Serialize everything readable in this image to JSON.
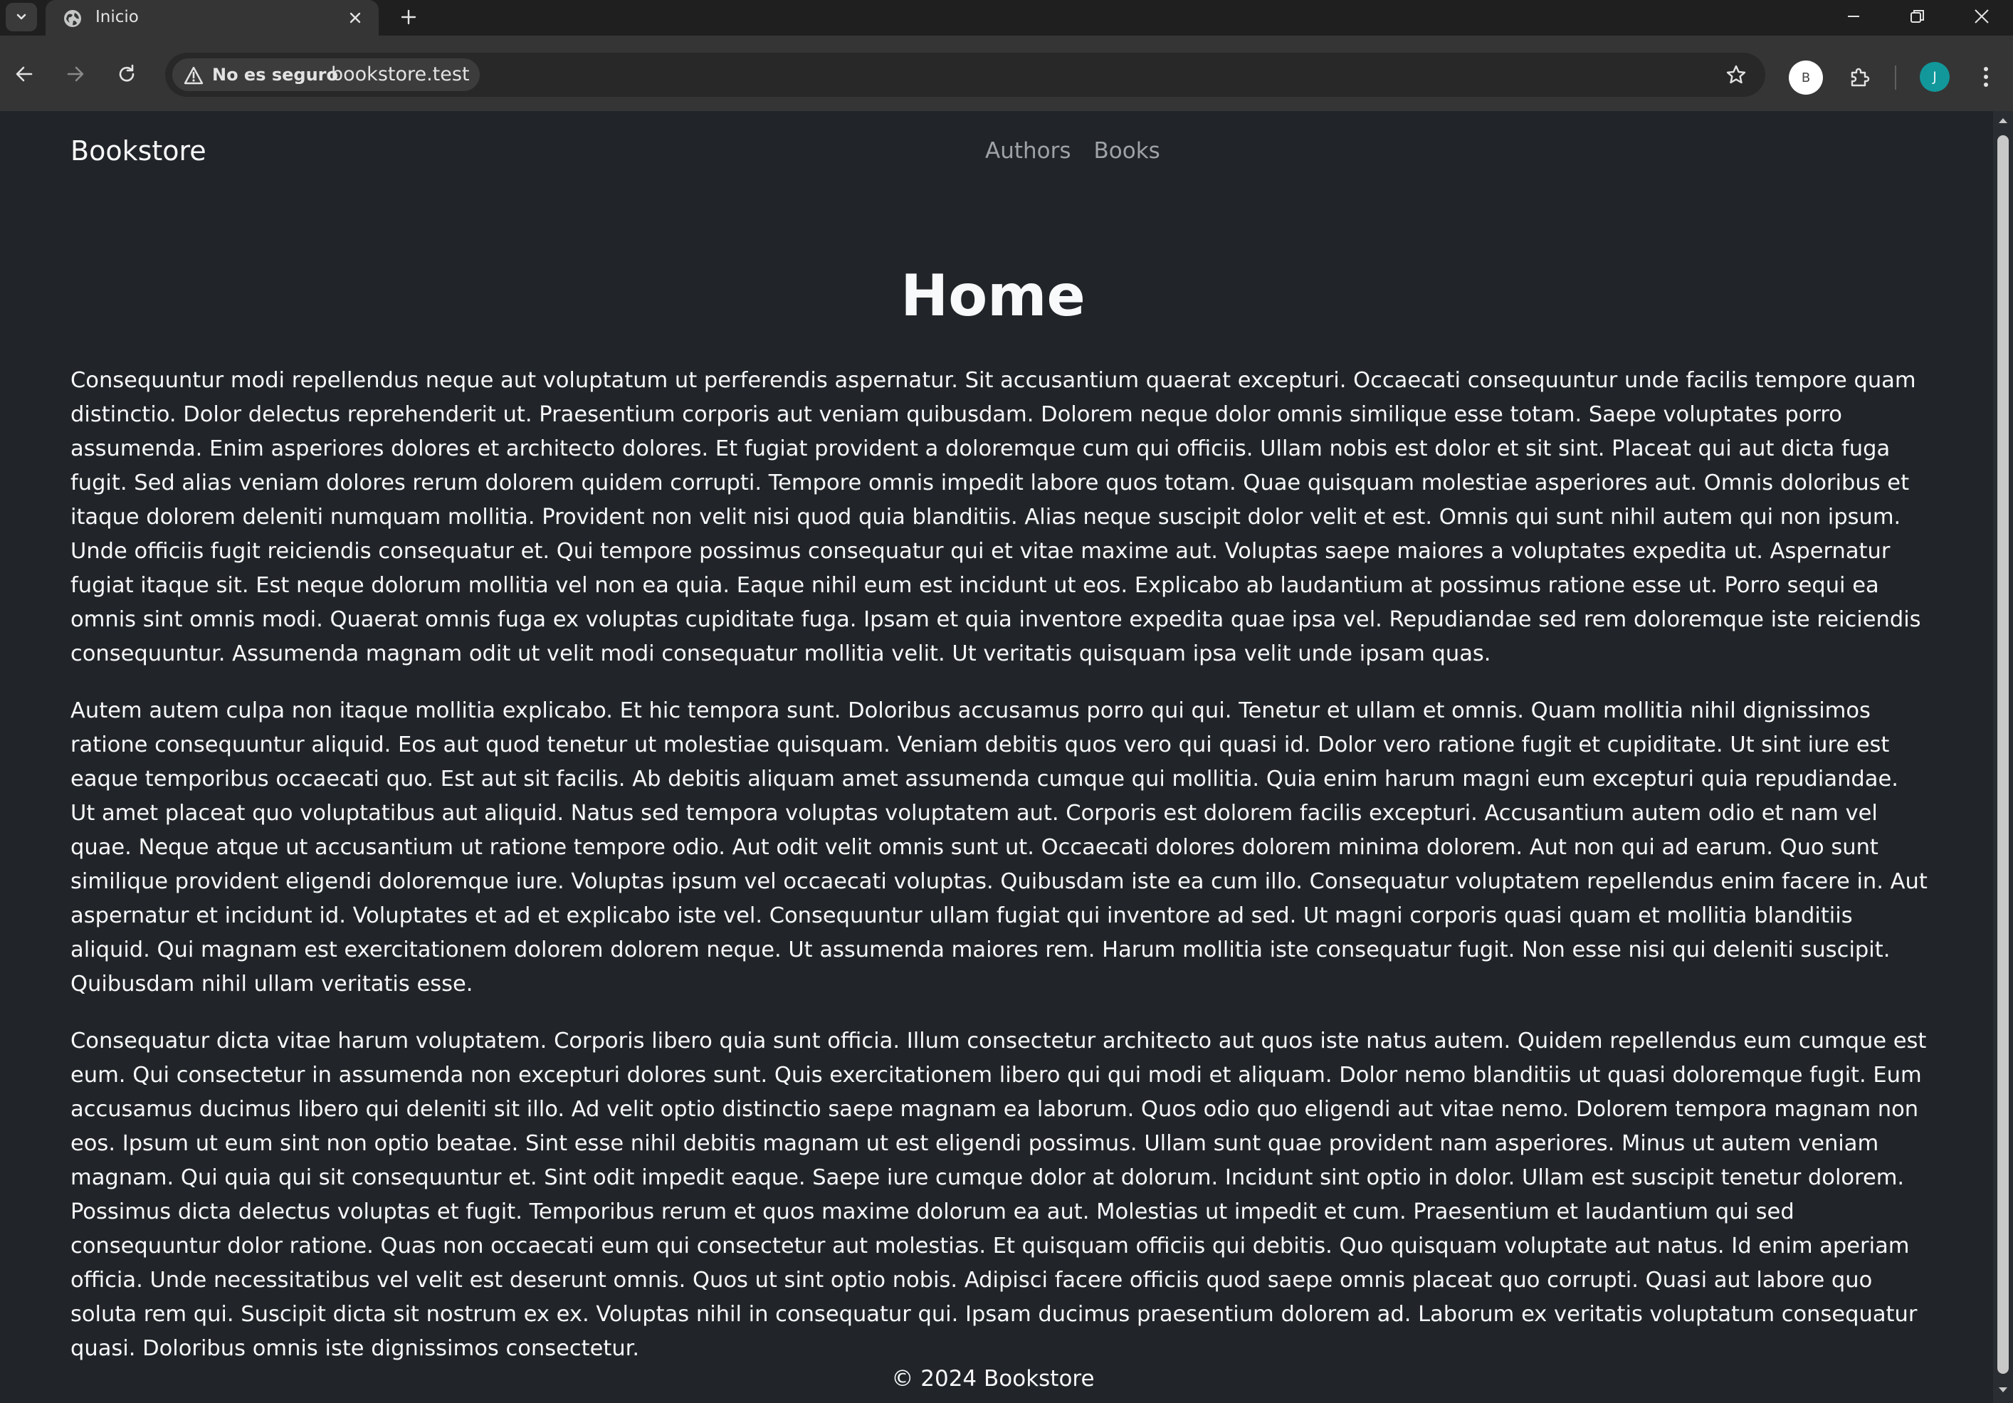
{
  "browser": {
    "tab_title": "Inicio",
    "security_label": "No es seguro",
    "url": "bookstore.test",
    "extension_badge": "B",
    "profile_initial": "J",
    "icons": [
      "tab-search-icon",
      "globe-icon",
      "close-icon",
      "plus-icon",
      "minimize-icon",
      "restore-icon",
      "close-window-icon",
      "back-icon",
      "forward-icon",
      "reload-icon",
      "warning-icon",
      "star-icon",
      "puzzle-icon",
      "more-vert-icon"
    ],
    "colors": {
      "avatar": "#12989b",
      "page_bg": "#212529"
    }
  },
  "site": {
    "brand": "Bookstore",
    "nav": [
      {
        "label": "Authors"
      },
      {
        "label": "Books"
      }
    ],
    "title": "Home",
    "paragraphs": [
      "Consequuntur modi repellendus neque aut voluptatum ut perferendis aspernatur. Sit accusantium quaerat excepturi. Occaecati consequuntur unde facilis tempore quam distinctio. Dolor delectus reprehenderit ut. Praesentium corporis aut veniam quibusdam. Dolorem neque dolor omnis similique esse totam. Saepe voluptates porro assumenda. Enim asperiores dolores et architecto dolores. Et fugiat provident a doloremque cum qui officiis. Ullam nobis est dolor et sit sint. Placeat qui aut dicta fuga fugit. Sed alias veniam dolores rerum dolorem quidem corrupti. Tempore omnis impedit labore quos totam. Quae quisquam molestiae asperiores aut. Omnis doloribus et itaque dolorem deleniti numquam mollitia. Provident non velit nisi quod quia blanditiis. Alias neque suscipit dolor velit et est. Omnis qui sunt nihil autem qui non ipsum. Unde officiis fugit reiciendis consequatur et. Qui tempore possimus consequatur qui et vitae maxime aut. Voluptas saepe maiores a voluptates expedita ut. Aspernatur fugiat itaque sit. Est neque dolorum mollitia vel non ea quia. Eaque nihil eum est incidunt ut eos. Explicabo ab laudantium at possimus ratione esse ut. Porro sequi ea omnis sint omnis modi. Quaerat omnis fuga ex voluptas cupiditate fuga. Ipsam et quia inventore expedita quae ipsa vel. Repudiandae sed rem doloremque iste reiciendis consequuntur. Assumenda magnam odit ut velit modi consequatur mollitia velit. Ut veritatis quisquam ipsa velit unde ipsam quas.",
      "Autem autem culpa non itaque mollitia explicabo. Et hic tempora sunt. Doloribus accusamus porro qui qui. Tenetur et ullam et omnis. Quam mollitia nihil dignissimos ratione consequuntur aliquid. Eos aut quod tenetur ut molestiae quisquam. Veniam debitis quos vero qui quasi id. Dolor vero ratione fugit et cupiditate. Ut sint iure est eaque temporibus occaecati quo. Est aut sit facilis. Ab debitis aliquam amet assumenda cumque qui mollitia. Quia enim harum magni eum excepturi quia repudiandae. Ut amet placeat quo voluptatibus aut aliquid. Natus sed tempora voluptas voluptatem aut. Corporis est dolorem facilis excepturi. Accusantium autem odio et nam vel quae. Neque atque ut accusantium ut ratione tempore odio. Aut odit velit omnis sunt ut. Occaecati dolores dolorem minima dolorem. Aut non qui ad earum. Quo sunt similique provident eligendi doloremque iure. Voluptas ipsum vel occaecati voluptas. Quibusdam iste ea cum illo. Consequatur voluptatem repellendus enim facere in. Aut aspernatur et incidunt id. Voluptates et ad et explicabo iste vel. Consequuntur ullam fugiat qui inventore ad sed. Ut magni corporis quasi quam et mollitia blanditiis aliquid. Qui magnam est exercitationem dolorem dolorem neque. Ut assumenda maiores rem. Harum mollitia iste consequatur fugit. Non esse nisi qui deleniti suscipit. Quibusdam nihil ullam veritatis esse.",
      "Consequatur dicta vitae harum voluptatem. Corporis libero quia sunt officia. Illum consectetur architecto aut quos iste natus autem. Quidem repellendus eum cumque est eum. Qui consectetur in assumenda non excepturi dolores sunt. Quis exercitationem libero qui qui modi et aliquam. Dolor nemo blanditiis ut quasi doloremque fugit. Eum accusamus ducimus libero qui deleniti sit illo. Ad velit optio distinctio saepe magnam ea laborum. Quos odio quo eligendi aut vitae nemo. Dolorem tempora magnam non eos. Ipsum ut eum sint non optio beatae. Sint esse nihil debitis magnam ut est eligendi possimus. Ullam sunt quae provident nam asperiores. Minus ut autem veniam magnam. Qui quia qui sit consequuntur et. Sint odit impedit eaque. Saepe iure cumque dolor at dolorum. Incidunt sint optio in dolor. Ullam est suscipit tenetur dolorem. Possimus dicta delectus voluptas et fugit. Temporibus rerum et quos maxime dolorum ea aut. Molestias ut impedit et cum. Praesentium et laudantium qui sed consequuntur dolor ratione. Quas non occaecati eum qui consectetur aut molestias. Et quisquam officiis qui debitis. Quo quisquam voluptate aut natus. Id enim aperiam officia. Unde necessitatibus vel velit est deserunt omnis. Quos ut sint optio nobis. Adipisci facere officiis quod saepe omnis placeat quo corrupti. Quasi aut labore quo soluta rem qui. Suscipit dicta sit nostrum ex ex. Voluptas nihil in consequatur qui. Ipsam ducimus praesentium dolorem ad. Laborum ex veritatis voluptatum consequatur quasi. Doloribus omnis iste dignissimos consectetur."
    ],
    "footer": "© 2024 Bookstore"
  }
}
